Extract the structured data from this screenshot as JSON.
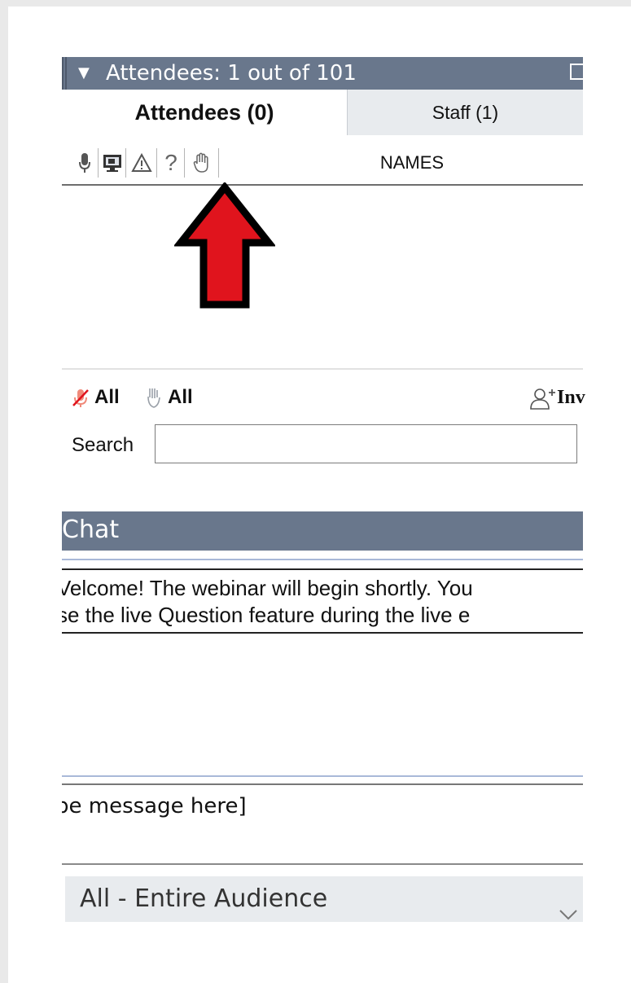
{
  "attendees_panel": {
    "title": "Attendees: 1 out of 101",
    "tabs": [
      {
        "label": "Attendees (0)",
        "active": true
      },
      {
        "label": "Staff (1)",
        "active": false
      }
    ],
    "columns": {
      "icons": [
        "microphone-icon",
        "screen-share-icon",
        "warning-icon",
        "question-icon",
        "raise-hand-icon"
      ],
      "question_glyph": "?",
      "names_label": "NAMES"
    },
    "attendees": [],
    "mute_all_label": "All",
    "lower_hands_label": "All",
    "invite_label": "Inv",
    "search_label": "Search",
    "search_value": ""
  },
  "chat_panel": {
    "title": "Chat",
    "messages": [
      "Velcome! The webinar will begin shortly. You",
      "se the live Question feature during the live e"
    ],
    "input_placeholder": "pe message here]",
    "recipient": "All - Entire Audience"
  },
  "colors": {
    "panel_header": "#69778c",
    "tab_inactive": "#e8ebee",
    "arrow_fill": "#e0141d",
    "mute_icon": "#f08a7a"
  }
}
